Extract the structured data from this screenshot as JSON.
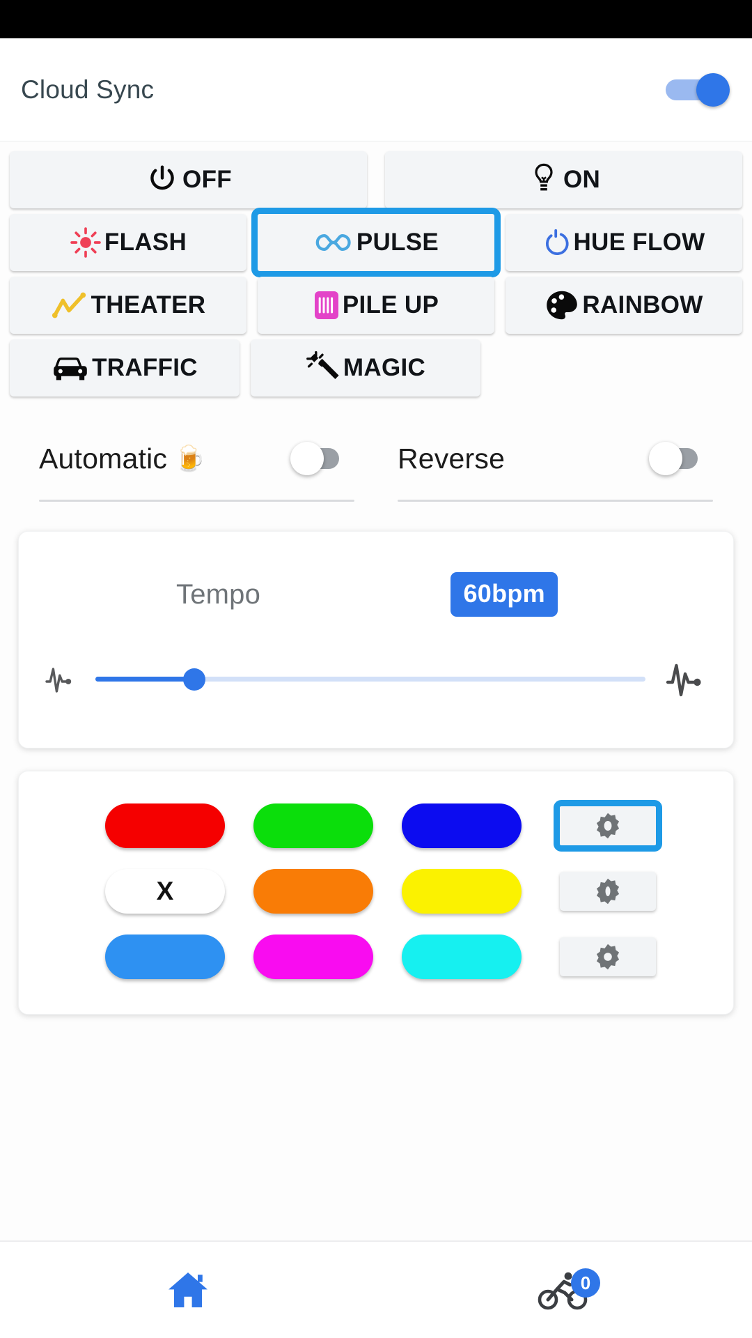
{
  "app": {
    "title": "Cloud Sync",
    "accent": "#2f76e8",
    "selection_border": "#1e9ae6"
  },
  "header": {
    "title": "Cloud Sync",
    "cloud_sync_toggle": {
      "name": "cloud-sync-switch",
      "state": "on"
    }
  },
  "power_buttons": [
    {
      "label": "OFF",
      "icon": "power-icon",
      "selected": false
    },
    {
      "label": "ON",
      "icon": "lightbulb-icon",
      "selected": false
    }
  ],
  "effects": [
    {
      "label": "FLASH",
      "icon": "sun-flash-icon",
      "icon_color": "#ef4056",
      "selected": false
    },
    {
      "label": "PULSE",
      "icon": "infinity-icon",
      "icon_color": "#4aa8e0",
      "selected": true
    },
    {
      "label": "HUE FLOW",
      "icon": "refresh-icon",
      "icon_color": "#3b6fe0",
      "selected": false
    },
    {
      "label": "THEATER",
      "icon": "zigzag-chart-icon",
      "icon_color": "#efc02a",
      "selected": false
    },
    {
      "label": "PILE UP",
      "icon": "barcode-icon",
      "icon_color": "#e343c8",
      "selected": false
    },
    {
      "label": "RAINBOW",
      "icon": "palette-icon",
      "icon_color": "#0a0a0a",
      "selected": false
    },
    {
      "label": "TRAFFIC",
      "icon": "car-icon",
      "icon_color": "#0a0a0a",
      "selected": false
    },
    {
      "label": "MAGIC",
      "icon": "magic-wand-icon",
      "icon_color": "#0a0a0a",
      "selected": false
    }
  ],
  "toggles": [
    {
      "label": "Automatic",
      "emoji": "🍺",
      "state": "off"
    },
    {
      "label": "Reverse",
      "emoji": "",
      "state": "off"
    }
  ],
  "tempo": {
    "label": "Tempo",
    "value_badge": "60bpm",
    "slider_percent": 18,
    "left_icon": "pulse-wave-small-icon",
    "right_icon": "pulse-wave-large-icon"
  },
  "color_grid": {
    "rows": [
      {
        "swatches": [
          {
            "name": "color-red",
            "color": "#f50000",
            "text": ""
          },
          {
            "name": "color-green",
            "color": "#0bde0b",
            "text": ""
          },
          {
            "name": "color-blue",
            "color": "#0c0cf0",
            "text": ""
          }
        ],
        "gear": {
          "name": "gear-button-1",
          "icon": "gear-icon",
          "selected": true
        }
      },
      {
        "swatches": [
          {
            "name": "color-off-white",
            "color": "#ffffff",
            "text": "X"
          },
          {
            "name": "color-orange",
            "color": "#f97c06",
            "text": ""
          },
          {
            "name": "color-yellow",
            "color": "#fbf200",
            "text": ""
          }
        ],
        "gear": {
          "name": "gear-button-2",
          "icon": "gear-icon",
          "selected": false
        }
      },
      {
        "swatches": [
          {
            "name": "color-light-blue",
            "color": "#2e91f2",
            "text": ""
          },
          {
            "name": "color-magenta",
            "color": "#f90cf0",
            "text": ""
          },
          {
            "name": "color-cyan",
            "color": "#16f0f0",
            "text": ""
          }
        ],
        "gear": {
          "name": "gear-button-3",
          "icon": "gear-icon",
          "selected": false
        }
      }
    ]
  },
  "bottom_nav": [
    {
      "name": "nav-home",
      "icon": "home-icon",
      "active": true,
      "badge": ""
    },
    {
      "name": "nav-rides",
      "icon": "cyclist-icon",
      "active": false,
      "badge": "0"
    }
  ]
}
